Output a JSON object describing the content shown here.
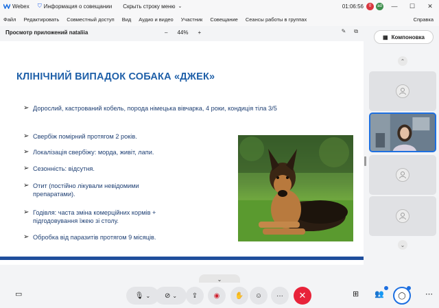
{
  "titlebar": {
    "app_name": "Webex",
    "meeting_info": "Информация о совещании",
    "hide_menu": "Скрыть строку меню",
    "time": "01:06:56",
    "badge_red": "0",
    "badge_green": "ad"
  },
  "menu": {
    "items": [
      "Файл",
      "Редактировать",
      "Совместный доступ",
      "Вид",
      "Аудио и видео",
      "Участник",
      "Совещание",
      "Сеансы работы в группах"
    ],
    "help": "Справка"
  },
  "toolbar": {
    "title": "Просмотр приложений nataliia",
    "zoom_minus": "–",
    "zoom_level": "44%",
    "zoom_plus": "+"
  },
  "layout_button": "Компоновка",
  "slide": {
    "title": "КЛІНІЧНИЙ ВИПАДОК СОБАКА «ДЖЕК»",
    "bullets": [
      "Дорослий, кастрований  кобель,  порода німецька вівчарка, 4 роки, кондиція тіла 3/5",
      "Свербіж помірний протягом 2 років.",
      "Локалізація свербіжу: морда, живіт, лапи.",
      "Сезонність: відсутня.",
      "Отит (постійно лікували невідомими препаратами).",
      "Годівля: часта зміна комерційних кормів + підгодовування їжею зі столу.",
      "Обробка від паразитів протягом 9 місяців."
    ],
    "bullet4_line1": "Отит (постійно лікували невідомими",
    "bullet4_line2": "препаратами).",
    "bullet5_line1": "Годівля: часта зміна комерційних кормів +",
    "bullet5_line2": "підгодовування їжею зі столу."
  },
  "colors": {
    "title_blue": "#1e5fa8",
    "bullet_text": "#1e3f73",
    "end_call": "#e8233a",
    "accent": "#1d6fe0"
  },
  "icons": [
    "webex-logo-icon",
    "shield-icon",
    "chevron-icon",
    "minimize-icon",
    "restore-icon",
    "close-icon",
    "layout-icon",
    "person-icon",
    "mic-icon",
    "video-off-icon",
    "share-icon",
    "record-icon",
    "raise-hand-icon",
    "reactions-icon",
    "more-icon",
    "end-call-icon",
    "captions-icon",
    "apps-icon",
    "participants-icon",
    "chat-icon"
  ]
}
